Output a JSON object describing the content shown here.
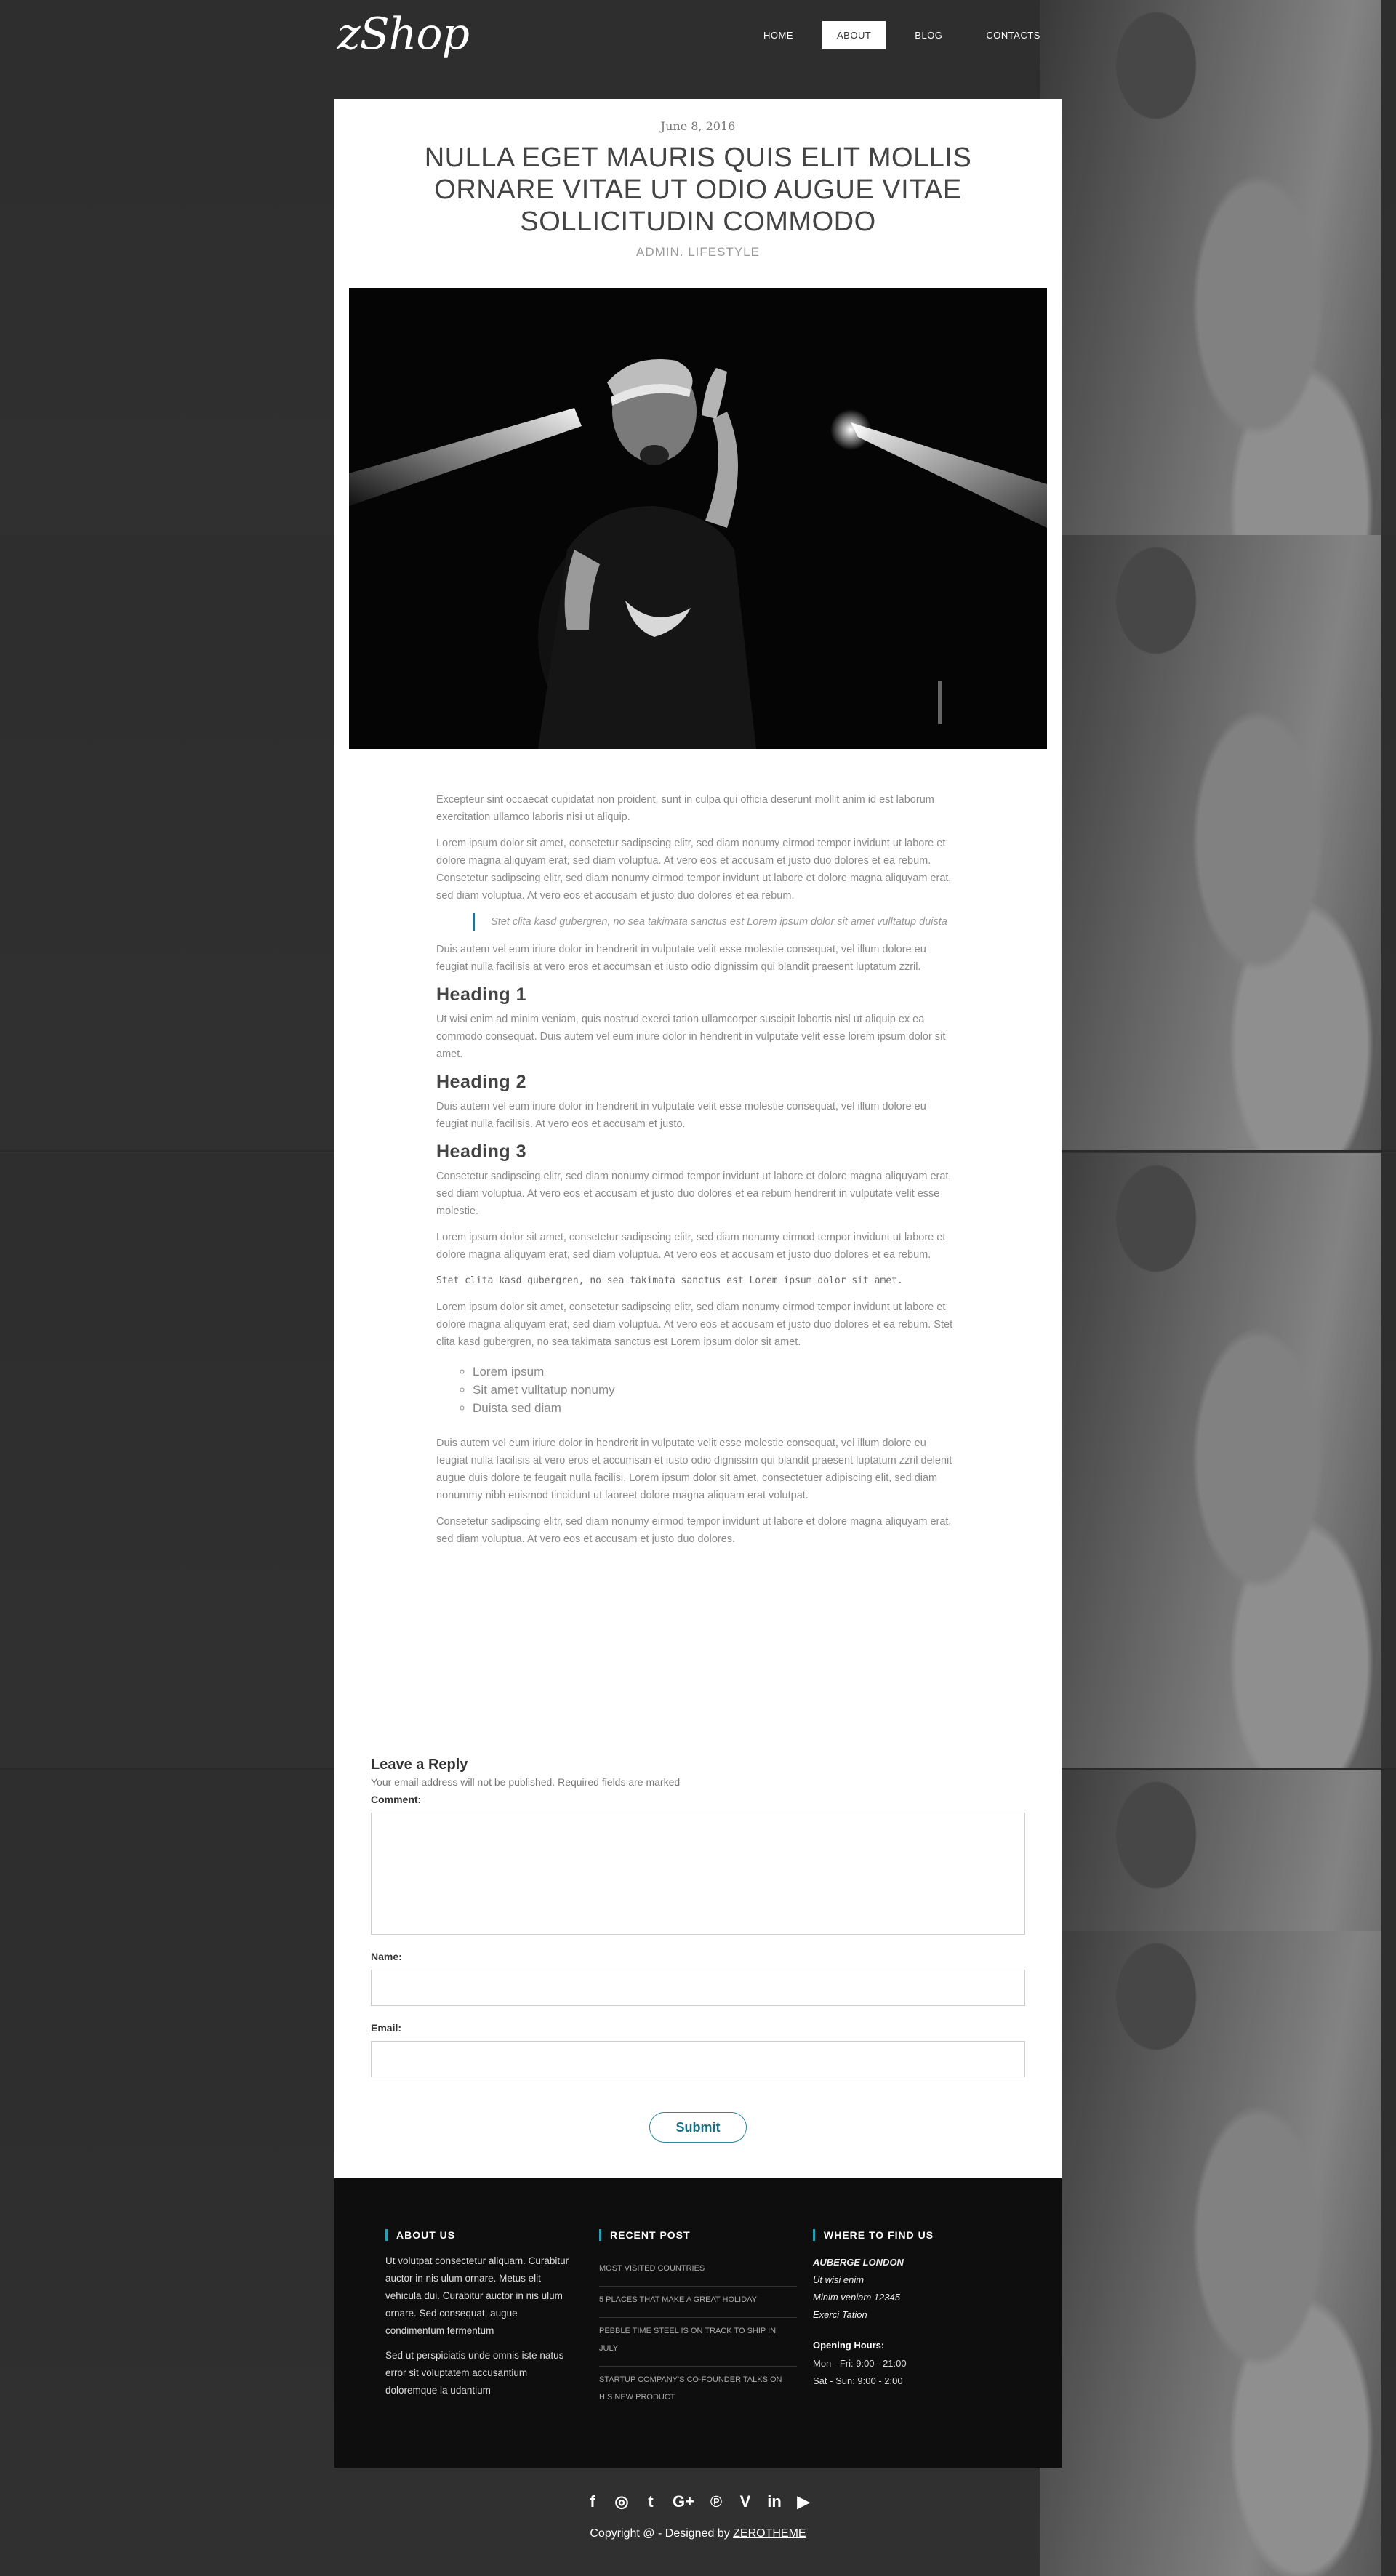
{
  "site": {
    "logo": "zShop"
  },
  "nav": [
    {
      "label": "HOME",
      "active": false
    },
    {
      "label": "ABOUT",
      "active": true
    },
    {
      "label": "BLOG",
      "active": false
    },
    {
      "label": "CONTACTS",
      "active": false
    }
  ],
  "post": {
    "date": "June 8, 2016",
    "title": "NULLA EGET MAURIS QUIS ELIT MOLLIS ORNARE VITAE UT ODIO AUGUE VITAE SOLLICITUDIN COMMODO",
    "meta": "ADMIN. LIFESTYLE",
    "p1": "Excepteur sint occaecat cupidatat non proident, sunt in culpa qui officia deserunt mollit anim id est laborum exercitation ullamco laboris nisi ut aliquip.",
    "p2": "Lorem ipsum dolor sit amet, consetetur sadipscing elitr, sed diam nonumy eirmod tempor invidunt ut labore et dolore magna aliquyam erat, sed diam voluptua. At vero eos et accusam et justo duo dolores et ea rebum. Consetetur sadipscing elitr, sed diam nonumy eirmod tempor invidunt ut labore et dolore magna aliquyam erat, sed diam voluptua. At vero eos et accusam et justo duo dolores et ea rebum.",
    "quote": "Stet clita kasd gubergren, no sea takimata sanctus est Lorem ipsum dolor sit amet vulltatup duista",
    "p3": "Duis autem vel eum iriure dolor in hendrerit in vulputate velit esse molestie consequat, vel illum dolore eu feugiat nulla facilisis at vero eros et accumsan et iusto odio dignissim qui blandit praesent luptatum zzril.",
    "h1": "Heading 1",
    "p4": "Ut wisi enim ad minim veniam, quis nostrud exerci tation ullamcorper suscipit lobortis nisl ut aliquip ex ea commodo consequat. Duis autem vel eum iriure dolor in hendrerit in vulputate velit esse lorem ipsum dolor sit amet.",
    "h2": "Heading 2",
    "p5": "Duis autem vel eum iriure dolor in hendrerit in vulputate velit esse molestie consequat, vel illum dolore eu feugiat nulla facilisis. At vero eos et accusam et justo.",
    "h3": "Heading 3",
    "p6": "Consetetur sadipscing elitr, sed diam nonumy eirmod tempor invidunt ut labore et dolore magna aliquyam erat, sed diam voluptua. At vero eos et accusam et justo duo dolores et ea rebum hendrerit in vulputate velit esse molestie.",
    "p7": "Lorem ipsum dolor sit amet, consetetur sadipscing elitr, sed diam nonumy eirmod tempor invidunt ut labore et dolore magna aliquyam erat, sed diam voluptua. At vero eos et accusam et justo duo dolores et ea rebum.",
    "code": "Stet clita kasd gubergren, no sea takimata sanctus est Lorem ipsum dolor sit amet.",
    "p8": "Lorem ipsum dolor sit amet, consetetur sadipscing elitr, sed diam nonumy eirmod tempor invidunt ut labore et dolore magna aliquyam erat, sed diam voluptua. At vero eos et accusam et justo duo dolores et ea rebum. Stet clita kasd gubergren, no sea takimata sanctus est Lorem ipsum dolor sit amet.",
    "list": [
      "Lorem ipsum",
      "Sit amet vulltatup nonumy",
      "Duista sed diam"
    ],
    "p9": "Duis autem vel eum iriure dolor in hendrerit in vulputate velit esse molestie consequat, vel illum dolore eu feugiat nulla facilisis at vero eros et accumsan et iusto odio dignissim qui blandit praesent luptatum zzril delenit augue duis dolore te feugait nulla facilisi. Lorem ipsum dolor sit amet, consectetuer adipiscing elit, sed diam nonummy nibh euismod tincidunt ut laoreet dolore magna aliquam erat volutpat.",
    "p10": "Consetetur sadipscing elitr, sed diam nonumy eirmod tempor invidunt ut labore et dolore magna aliquyam erat, sed diam voluptua. At vero eos et accusam et justo duo dolores."
  },
  "reply": {
    "title": "Leave a Reply",
    "note": "Your email address will not be published. Required fields are marked",
    "comment_label": "Comment:",
    "name_label": "Name:",
    "email_label": "Email:",
    "comment_value": "",
    "name_value": "",
    "email_value": "",
    "submit_label": "Submit"
  },
  "footer": {
    "about_title": "ABOUT US",
    "about_p1": "Ut volutpat consectetur aliquam. Curabitur auctor in nis ulum ornare. Metus elit vehicula dui. Curabitur auctor in nis ulum ornare. Sed consequat, augue condimentum fermentum",
    "about_p2": "Sed ut perspiciatis unde omnis iste natus error sit voluptatem accusantium doloremque la udantium",
    "recent_title": "RECENT POST",
    "recent": [
      "MOST VISITED COUNTRIES",
      "5 PLACES THAT MAKE A GREAT HOLIDAY",
      "PEBBLE TIME STEEL IS ON TRACK TO SHIP IN JULY",
      "STARTUP COMPANY'S CO-FOUNDER TALKS ON HIS NEW PRODUCT"
    ],
    "find_title": "WHERE TO FIND US",
    "address": [
      "AUBERGE LONDON",
      "Ut wisi enim",
      "Minim veniam 12345",
      "Exerci Tation"
    ],
    "hours_title": "Opening Hours:",
    "hours": [
      "Mon - Fri: 9:00 - 21:00",
      "Sat - Sun: 9:00 - 2:00"
    ],
    "social_icons": [
      "facebook-icon",
      "instagram-icon",
      "twitter-icon",
      "google-plus-icon",
      "pinterest-icon",
      "vimeo-icon",
      "linkedin-icon",
      "youtube-icon"
    ],
    "copyright_text": "Copyright @ - Designed by",
    "copyright_link": "ZEROTHEME"
  },
  "colors": {
    "background": "#333333",
    "accent": "#2aa0b5",
    "submit_text": "#1a6f80",
    "footer_bg": "#0e0e0e"
  }
}
